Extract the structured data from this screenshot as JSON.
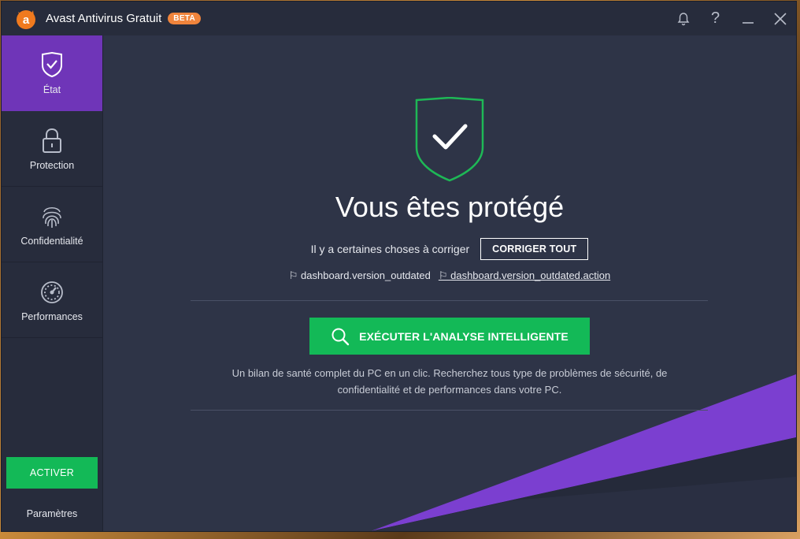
{
  "titlebar": {
    "app_title": "Avast Antivirus Gratuit",
    "badge": "BETA",
    "icons": [
      "bell-icon",
      "help-icon",
      "minimize-icon",
      "close-icon"
    ],
    "help_glyph": "?"
  },
  "sidebar": {
    "items": [
      {
        "label": "État",
        "icon": "shield-check-icon",
        "active": true
      },
      {
        "label": "Protection",
        "icon": "lock-icon",
        "active": false
      },
      {
        "label": "Confidentialité",
        "icon": "fingerprint-icon",
        "active": false
      },
      {
        "label": "Performances",
        "icon": "speedometer-icon",
        "active": false
      }
    ],
    "activate_label": "ACTIVER",
    "settings_label": "Paramètres"
  },
  "main": {
    "status_title": "Vous êtes protégé",
    "issue_text": "Il y a certaines choses à corriger",
    "fix_all_label": "CORRIGER TOUT",
    "link_1": "⚐ dashboard.version_outdated",
    "link_2": "⚐ dashboard.version_outdated.action",
    "scan_button_label": "EXÉCUTER L'ANALYSE INTELLIGENTE",
    "description": "Un bilan de santé complet du PC en un clic. Recherchez tous type de problèmes de sécurité, de confidentialité et de performances dans votre PC."
  },
  "colors": {
    "accent_purple": "#6f35b8",
    "accent_green": "#13b957",
    "brand_orange": "#f0843c",
    "background": "#2e3447",
    "sidebar": "#272c3c"
  }
}
